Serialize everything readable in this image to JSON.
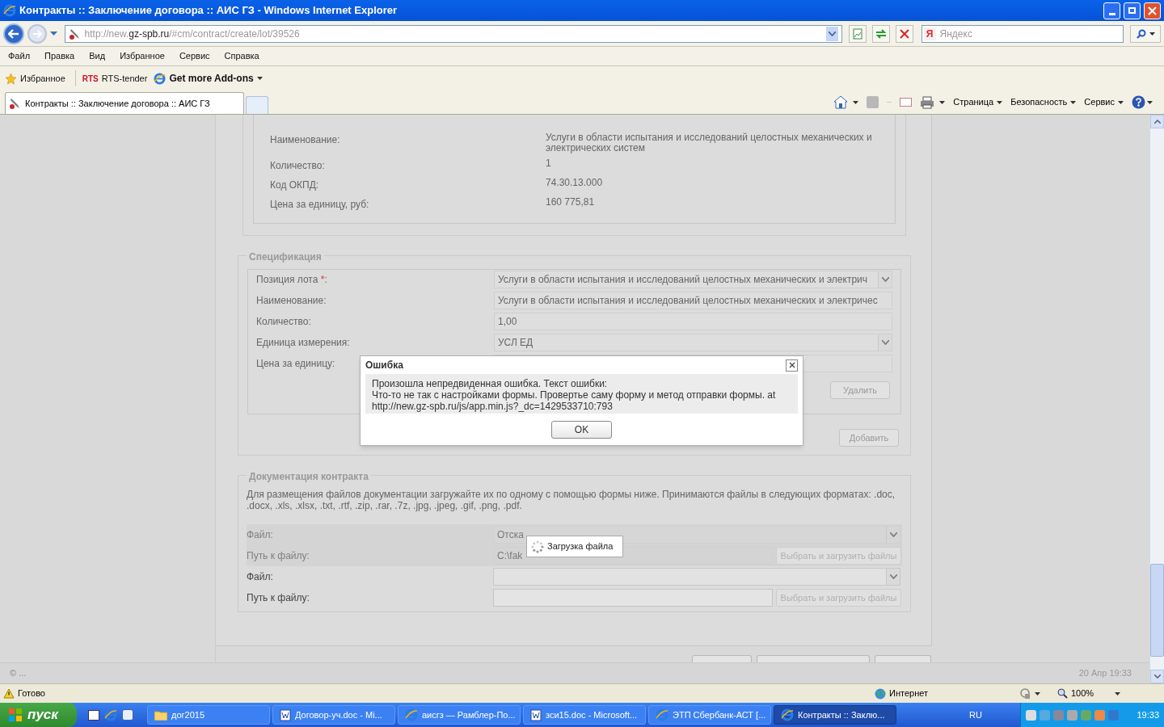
{
  "window": {
    "title": "Контракты :: Заключение договора :: АИС ГЗ - Windows Internet Explorer"
  },
  "address_bar": {
    "url_prefix": "http://new.",
    "url_host": "gz-spb.ru",
    "url_path": "/#cm/contract/create/lot/39526"
  },
  "search": {
    "placeholder": "Яндекс",
    "logo": "Я"
  },
  "menu": [
    "Файл",
    "Правка",
    "Вид",
    "Избранное",
    "Сервис",
    "Справка"
  ],
  "favorites_bar": [
    {
      "kind": "favorites",
      "label": "Избранное"
    },
    {
      "kind": "rts",
      "badge": "RTS",
      "label": "RTS-tender"
    },
    {
      "kind": "addons",
      "label": "Get more Add-ons"
    }
  ],
  "tabs": [
    {
      "label": "Контракты :: Заключение договора :: АИС ГЗ",
      "selected": true
    }
  ],
  "command_bar": [
    "Страница",
    "Безопасность",
    "Сервис"
  ],
  "lot_info": [
    {
      "label": "Наименование:",
      "value": "Услуги в области испытания и исследований целостных механических и электрических систем"
    },
    {
      "label": "Количество:",
      "value": "1"
    },
    {
      "label": "Код ОКПД:",
      "value": "74.30.13.000"
    },
    {
      "label": "Цена за единицу, руб:",
      "value": "160 775,81"
    }
  ],
  "specification": {
    "title": "Спецификация",
    "fields": [
      {
        "label": "Позиция лота",
        "required_mark": "*",
        "label_end": ":",
        "kind": "select",
        "value": "Услуги в области испытания и исследований целостных механических и электрич"
      },
      {
        "label": "Наименование:",
        "kind": "input",
        "value": "Услуги в области испытания и исследований целостных механических и электричес"
      },
      {
        "label": "Количество:",
        "kind": "input",
        "value": "1,00"
      },
      {
        "label": "Единица измерения:",
        "kind": "select",
        "value": "УСЛ ЕД"
      },
      {
        "label": "Цена за единицу:",
        "kind": "input"
      }
    ],
    "delete_button": "Удалить",
    "add_button": "Добавить"
  },
  "documentation": {
    "title": "Документация контракта",
    "note": "Для размещения файлов документации загружайте их по одному с помощью формы ниже. Принимаются файлы в следующих форматах: .doc, .docx, .xls, .xlsx, .txt, .rtf, .zip, .rar, .7z, .jpg, .jpeg, .gif, .png, .pdf.",
    "rows": [
      {
        "kind": "select",
        "label": "Файл:",
        "value": "Отска",
        "disabled": true
      },
      {
        "kind": "path",
        "label": "Путь к файлу:",
        "value": "C:\\fak",
        "button": "Выбрать и загрузить файлы",
        "disabled": true
      },
      {
        "kind": "select",
        "label": "Файл:",
        "disabled": false
      },
      {
        "kind": "path",
        "label": "Путь к файлу:",
        "button": "Выбрать и загрузить файлы",
        "disabled": false
      }
    ]
  },
  "dialog": {
    "title": "Ошибка",
    "message": [
      "Произошла непредвиденная ошибка. Текст ошибки:",
      "Что-то не так с настройками формы. Провертье саму форму и метод отправки формы. at",
      "http://new.gz-spb.ru/js/app.min.js?_dc=1429533710:793"
    ],
    "ok": "OK"
  },
  "loading": {
    "text": "Загрузка файла"
  },
  "page_footer": {
    "left": "© ...",
    "right": "20 Апр 19:33"
  },
  "status_bar": {
    "text": "Готово",
    "zone": "Интернет",
    "zoom": "100%"
  },
  "taskbar": {
    "start": "пуск",
    "buttons": [
      {
        "kind": "folder",
        "label": "дог2015",
        "selected": false
      },
      {
        "kind": "word",
        "label": "Договор-уч.doc - Mi...",
        "selected": false
      },
      {
        "kind": "ie",
        "label": "аисгз — Рамблер-По...",
        "selected": false
      },
      {
        "kind": "word",
        "label": "зси15.doc - Microsoft...",
        "selected": false
      },
      {
        "kind": "ie",
        "label": "ЭТП Сбербанк-АСТ [...",
        "selected": false
      },
      {
        "kind": "ie",
        "label": "Контракты :: Заклю...",
        "selected": true
      }
    ],
    "lang": "RU",
    "clock": "19:33"
  }
}
